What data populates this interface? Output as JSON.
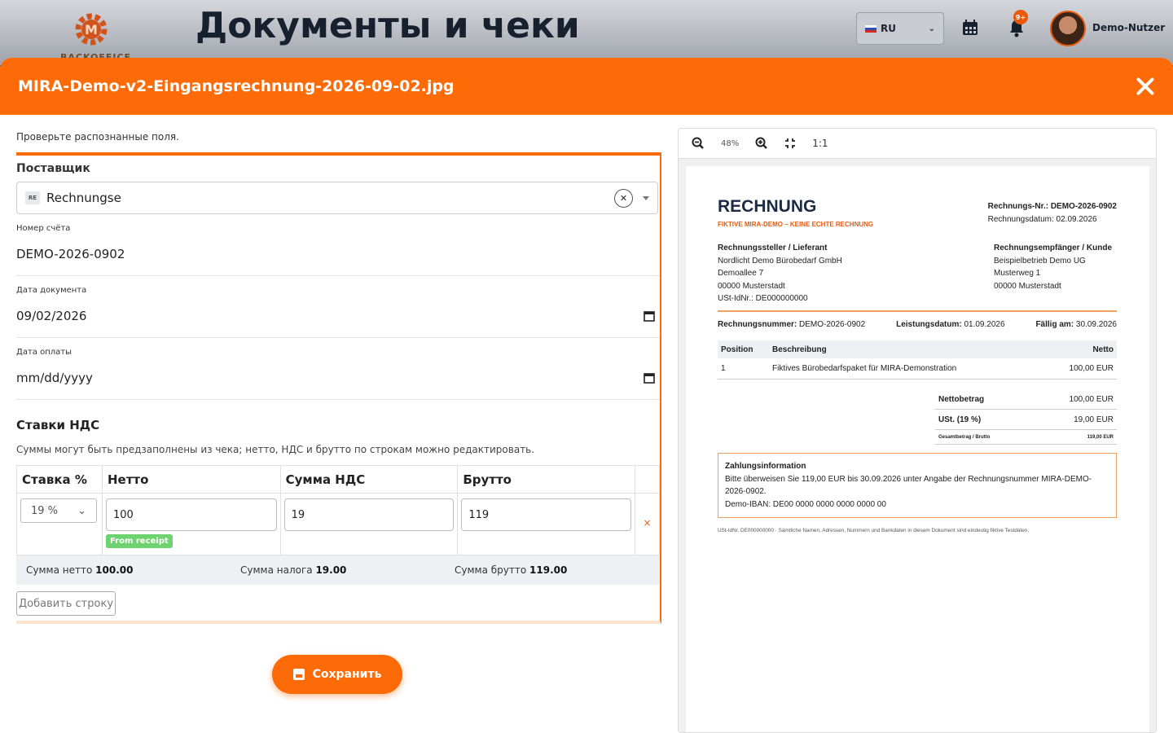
{
  "app": {
    "page_title": "Документы и чеки",
    "logo_text": "BACKOFFICE",
    "language": "RU",
    "notifications_badge": "9+",
    "user_name": "Demo-Nutzer"
  },
  "modal": {
    "title": "MIRA-Demo-v2-Eingangsrechnung-2026-09-02.jpg",
    "hint": "Проверьте распознанные поля.",
    "supplier": {
      "label": "Поставщик",
      "badge": "RE",
      "value": "Rechnungse"
    },
    "fields": [
      {
        "label": "Номер счёта",
        "value": "DEMO-2026-0902"
      },
      {
        "label": "Дата документа",
        "value": "09/02/2026"
      },
      {
        "label": "Дата оплаты",
        "value": "mm/dd/yyyy"
      }
    ],
    "vat": {
      "title": "Ставки НДС",
      "hint": "Суммы могут быть предзаполнены из чека; нетто, НДС и брутто по строкам можно редактировать.",
      "headers": [
        "Ставка %",
        "Нетто",
        "Сумма НДС",
        "Брутто"
      ],
      "row": {
        "rate": "19 %",
        "net": "100",
        "tax": "19",
        "gross": "119",
        "badge": "From receipt",
        "delete": "×"
      },
      "totals": {
        "net_label": "Сумма нетто",
        "net_value": "100.00",
        "tax_label": "Сумма налога",
        "tax_value": "19.00",
        "gross_label": "Сумма брутто",
        "gross_value": "119.00"
      },
      "add_row": "Добавить строку"
    },
    "save": "Сохранить"
  },
  "viewer": {
    "zoom": "48%",
    "ratio": "1:1",
    "doc": {
      "title": "RECHNUNG",
      "subtitle": "FIKTIVE MIRA-DEMO – KEINE ECHTE RECHNUNG",
      "meta_number": "Rechnungs-Nr.: DEMO-2026-0902",
      "meta_date": "Rechnungsdatum: 02.09.2026",
      "seller_head": "Rechnungssteller / Lieferant",
      "seller_lines": [
        "Nordlicht Demo Bürobedarf GmbH",
        "Demoallee 7",
        "00000 Musterstadt",
        "USt-IdNr.: DE000000000"
      ],
      "buyer_head": "Rechnungsempfänger / Kunde",
      "buyer_lines": [
        "Beispielbetrieb Demo UG",
        "Musterweg 1",
        "00000 Musterstadt"
      ],
      "ref_number_label": "Rechnungsnummer:",
      "ref_number": "DEMO-2026-0902",
      "ref_service_label": "Leistungsdatum:",
      "ref_service": "01.09.2026",
      "ref_due_label": "Fällig am:",
      "ref_due": "30.09.2026",
      "table_headers": [
        "Position",
        "Beschreibung",
        "Netto"
      ],
      "table_row": [
        "1",
        "Fiktives Bürobedarfspaket für MIRA-Demonstration",
        "100,00 EUR"
      ],
      "sum_net_label": "Nettobetrag",
      "sum_net": "100,00 EUR",
      "sum_tax_label": "USt. (19 %)",
      "sum_tax": "19,00 EUR",
      "sum_gross_label": "Gesamtbetrag / Brutto",
      "sum_gross": "119,00 EUR",
      "pay_head": "Zahlungsinformation",
      "pay_text": "Bitte überweisen Sie 119,00 EUR bis 30.09.2026 unter Angabe der Rechnungsnummer MIRA-DEMO-2026-0902.",
      "pay_iban": "Demo-IBAN: DE00 0000 0000 0000 0000 00",
      "footer": "USt-IdNr. DE000000000 · Sämtliche Namen, Adressen, Nummern und Bankdaten in diesem Dokument sind eindeutig fiktive Testdaten."
    }
  }
}
